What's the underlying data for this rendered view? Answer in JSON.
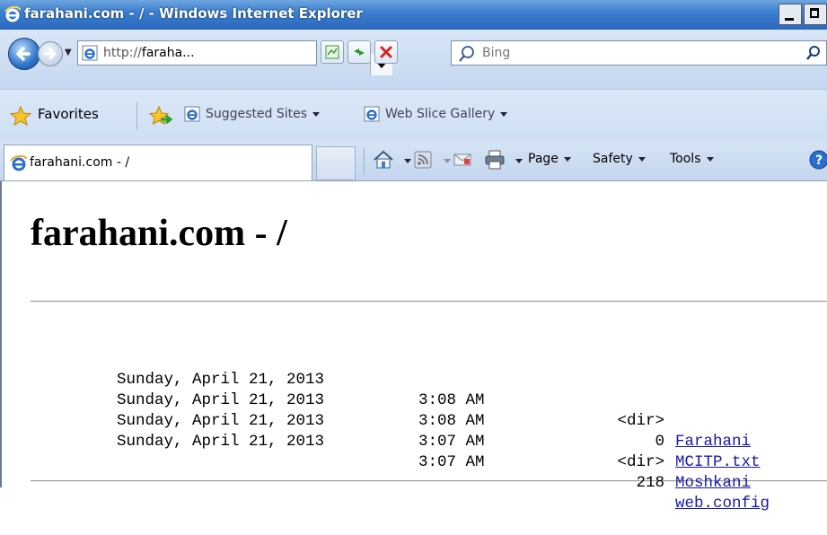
{
  "window": {
    "title": "farahani.com - / - Windows Internet Explorer"
  },
  "address_bar": {
    "url_prefix": "http://",
    "url_host": "faraha...",
    "search_placeholder": "Bing"
  },
  "favorites_bar": {
    "favorites_label": "Favorites",
    "items": [
      {
        "label": "Suggested Sites"
      },
      {
        "label": "Web Slice Gallery"
      }
    ]
  },
  "tab": {
    "label": "farahani.com - /"
  },
  "command_bar": {
    "page": "Page",
    "safety": "Safety",
    "tools": "Tools"
  },
  "page": {
    "heading": "farahani.com - /",
    "entries": [
      {
        "date": "Sunday, April 21, 2013",
        "time": "3:08 AM",
        "size": "<dir>",
        "name": "Farahani"
      },
      {
        "date": "Sunday, April 21, 2013",
        "time": "3:08 AM",
        "size": "0",
        "name": "MCITP.txt"
      },
      {
        "date": "Sunday, April 21, 2013",
        "time": "3:07 AM",
        "size": "<dir>",
        "name": "Moshkani"
      },
      {
        "date": "Sunday, April 21, 2013",
        "time": "3:07 AM",
        "size": "218",
        "name": "web.config"
      }
    ]
  },
  "colors": {
    "link": "#1a1aa6",
    "titlebar": "#2a68bd"
  }
}
